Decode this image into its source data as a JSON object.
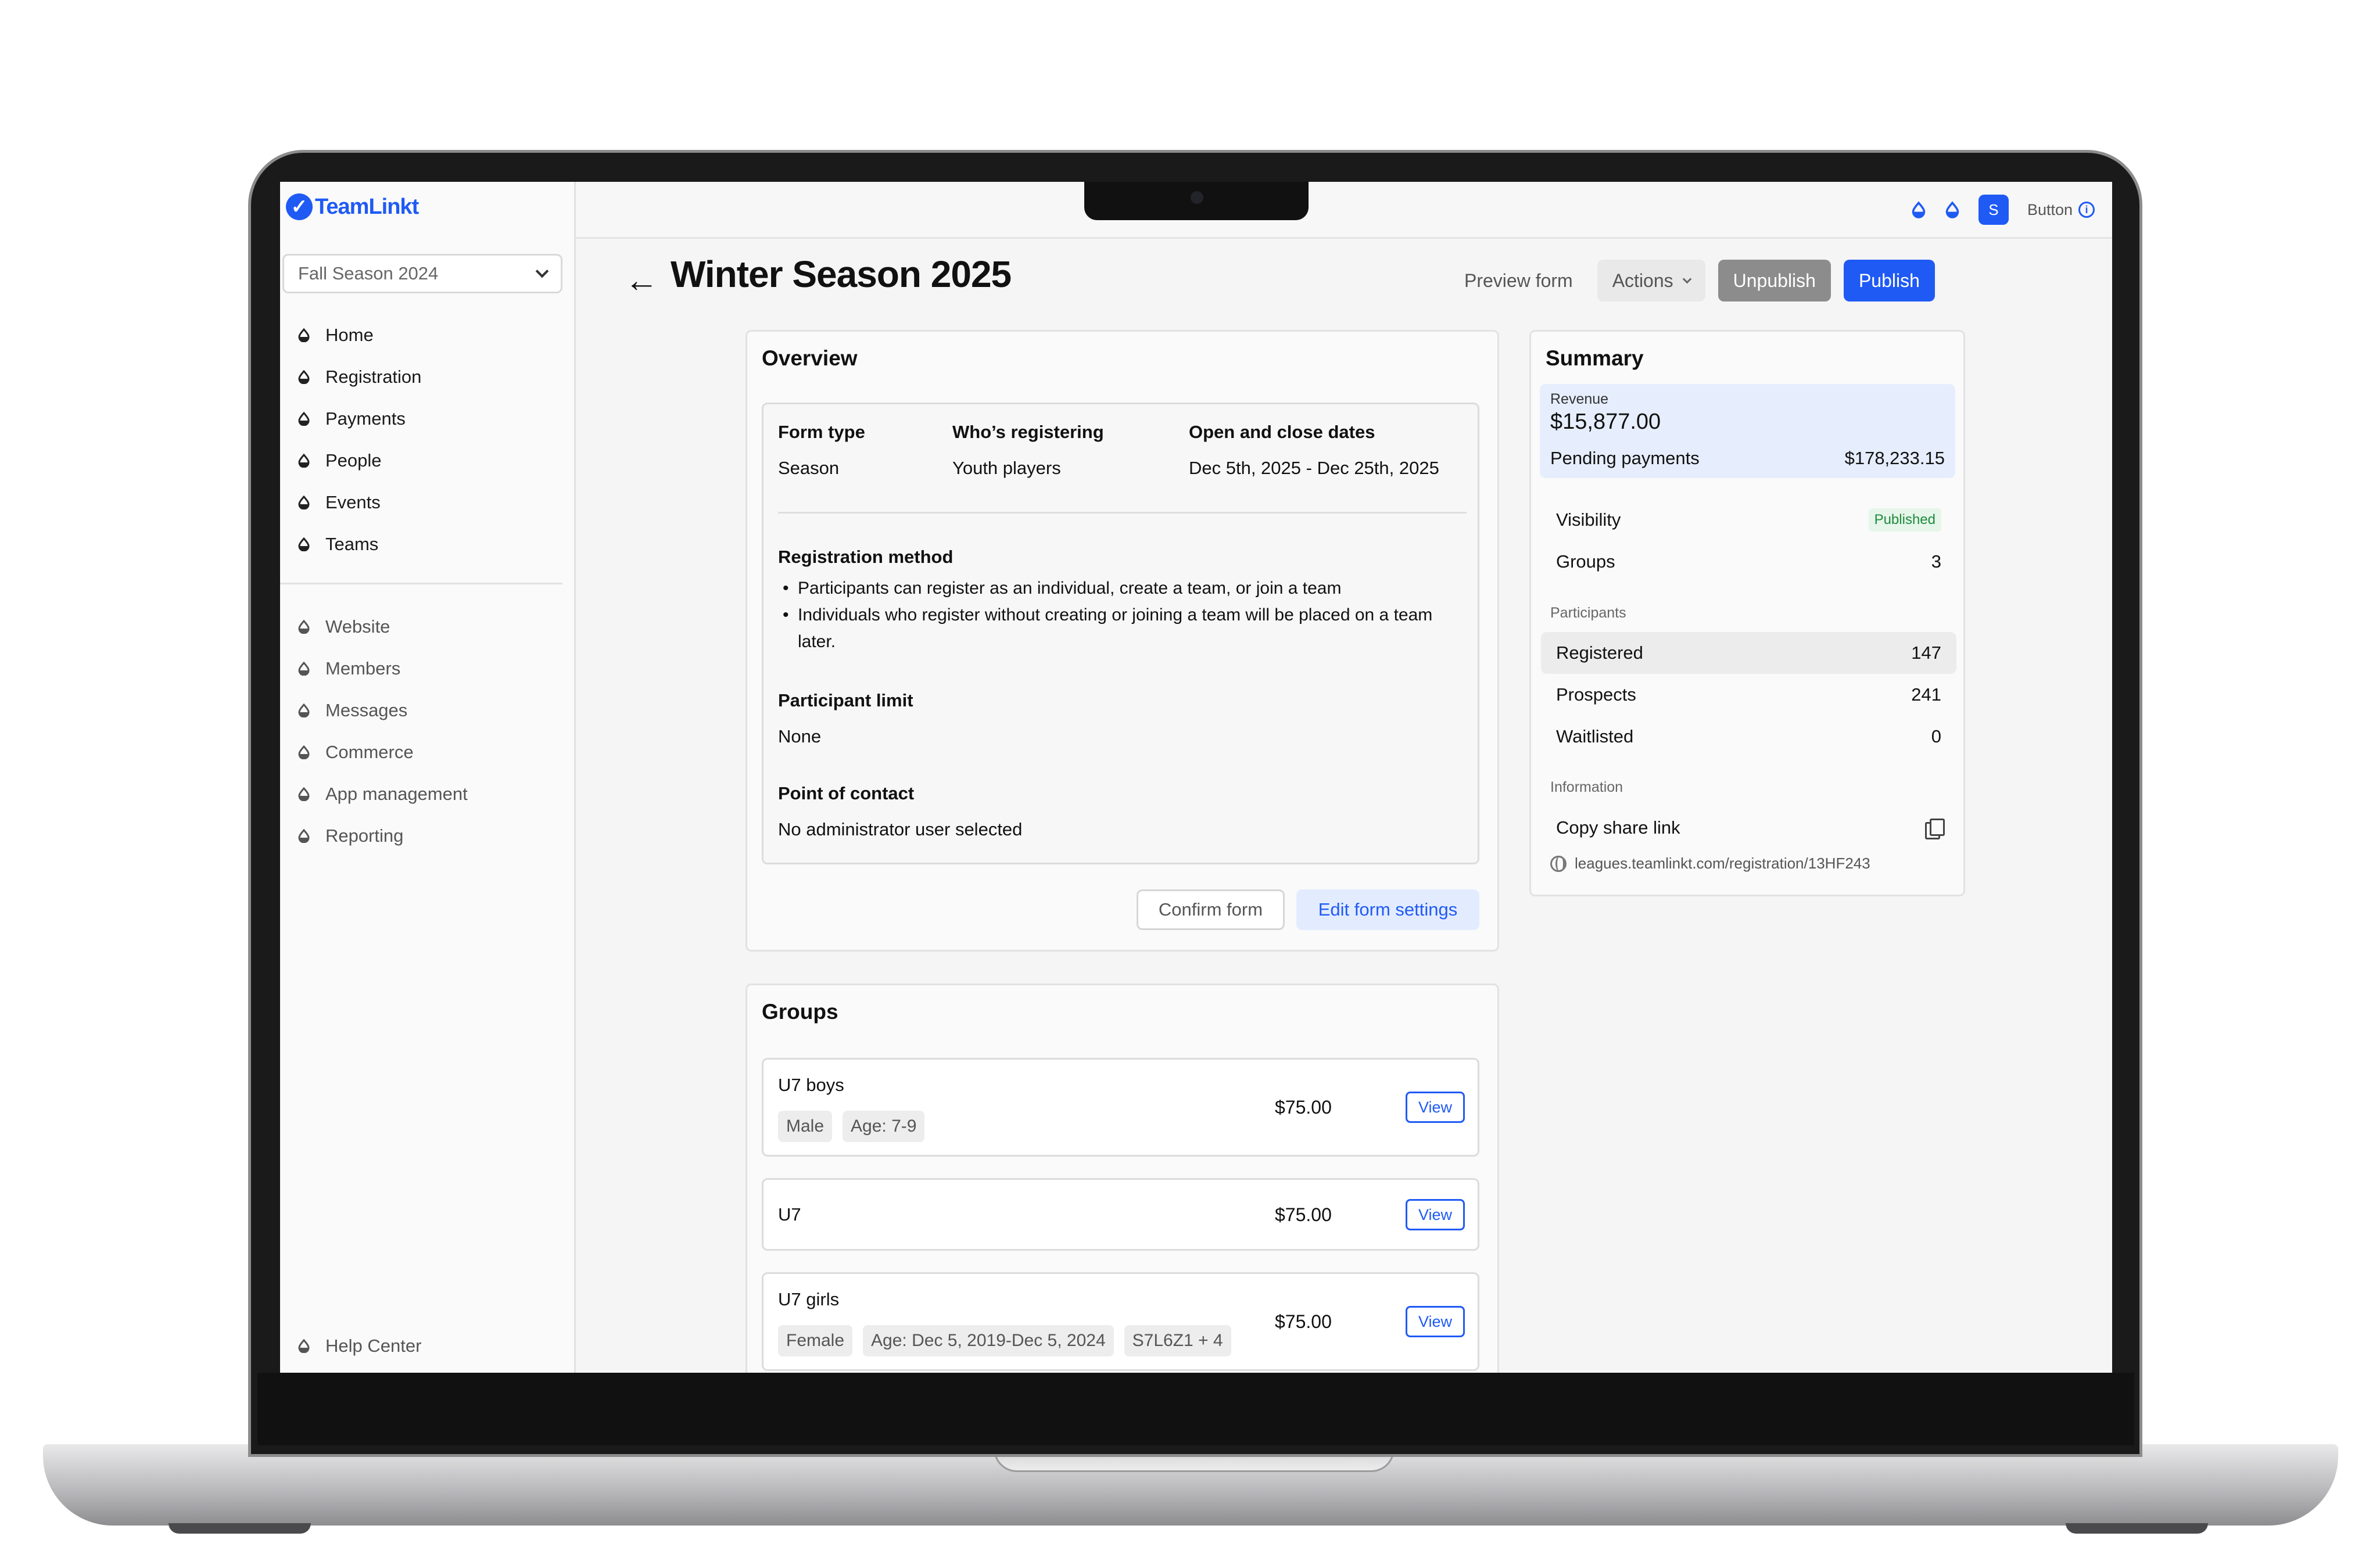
{
  "app": {
    "brand": "TeamLinkt",
    "season_selector": "Fall Season 2024"
  },
  "sidebar": {
    "primary": [
      {
        "label": "Home"
      },
      {
        "label": "Registration"
      },
      {
        "label": "Payments"
      },
      {
        "label": "People"
      },
      {
        "label": "Events"
      },
      {
        "label": "Teams"
      }
    ],
    "secondary": [
      {
        "label": "Website"
      },
      {
        "label": "Members"
      },
      {
        "label": "Messages"
      },
      {
        "label": "Commerce"
      },
      {
        "label": "App management"
      },
      {
        "label": "Reporting"
      }
    ],
    "footer": {
      "label": "Help Center"
    }
  },
  "topbar": {
    "avatar_initial": "S",
    "button_label": "Button",
    "info_glyph": "i"
  },
  "header": {
    "back_glyph": "←",
    "title": "Winter Season 2025",
    "preview_label": "Preview form",
    "actions_label": "Actions",
    "unpublish_label": "Unpublish",
    "publish_label": "Publish"
  },
  "overview": {
    "title": "Overview",
    "form_type_label": "Form type",
    "form_type_value": "Season",
    "who_label": "Who’s registering",
    "who_value": "Youth players",
    "dates_label": "Open and close dates",
    "dates_value": "Dec 5th, 2025 - Dec 25th, 2025",
    "method_label": "Registration method",
    "method_items": [
      "Participants can register as an individual, create a team, or join a team",
      "Individuals who register without creating or joining a team will be placed on a team later."
    ],
    "limit_label": "Participant limit",
    "limit_value": "None",
    "contact_label": "Point of contact",
    "contact_value": "No administrator user selected",
    "confirm_label": "Confirm form",
    "edit_label": "Edit form settings"
  },
  "groups": {
    "title": "Groups",
    "view_label": "View",
    "items": [
      {
        "name": "U7 boys",
        "price": "$75.00",
        "tags": [
          "Male",
          "Age: 7-9"
        ]
      },
      {
        "name": "U7",
        "price": "$75.00",
        "tags": []
      },
      {
        "name": "U7 girls",
        "price": "$75.00",
        "tags": [
          "Female",
          "Age: Dec 5, 2019-Dec 5, 2024",
          "S7L6Z1 + 4"
        ]
      }
    ]
  },
  "summary": {
    "title": "Summary",
    "revenue_label": "Revenue",
    "revenue_value": "$15,877.00",
    "pending_label": "Pending payments",
    "pending_value": "$178,233.15",
    "visibility_label": "Visibility",
    "visibility_value": "Published",
    "groups_label": "Groups",
    "groups_value": "3",
    "participants_section": "Participants",
    "registered_label": "Registered",
    "registered_value": "147",
    "prospects_label": "Prospects",
    "prospects_value": "241",
    "waitlisted_label": "Waitlisted",
    "waitlisted_value": "0",
    "information_section": "Information",
    "copy_link_label": "Copy share link",
    "share_url": "leagues.teamlinkt.com/registration/13HF243"
  },
  "colors": {
    "brand": "#1f5af5",
    "published_badge": "#1f8a3d"
  }
}
